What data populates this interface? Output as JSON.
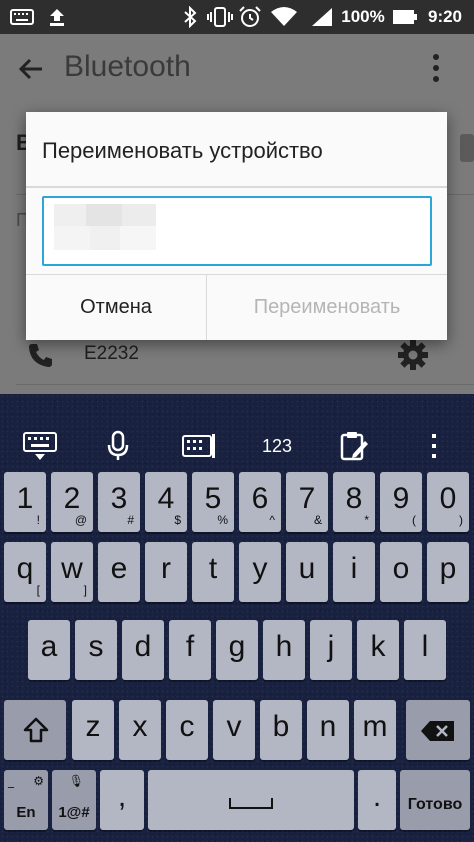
{
  "status_bar": {
    "battery_percent": "100%",
    "time": "9:20",
    "icons": [
      "keyboard-icon",
      "upload-icon",
      "bluetooth-icon",
      "vibrate-icon",
      "alarm-icon",
      "wifi-icon",
      "signal-icon",
      "battery-icon"
    ]
  },
  "app": {
    "title": "Bluetooth",
    "section_letter": "B",
    "paired_letter": "П",
    "devices": [
      {
        "name": "E2232"
      }
    ]
  },
  "dialog": {
    "title": "Переименовать устройство",
    "input_value": "",
    "cancel_label": "Отмена",
    "rename_label": "Переименовать"
  },
  "keyboard": {
    "toolbar_numbers_label": "123",
    "toolbar_icons": [
      "keyboard-hide-icon",
      "microphone-icon",
      "keyboard-mode-icon",
      "clipboard-icon",
      "more-vertical-icon"
    ],
    "rows": [
      [
        {
          "main": "1",
          "sub": "!"
        },
        {
          "main": "2",
          "sub": "@"
        },
        {
          "main": "3",
          "sub": "#"
        },
        {
          "main": "4",
          "sub": "$"
        },
        {
          "main": "5",
          "sub": "%"
        },
        {
          "main": "6",
          "sub": "^"
        },
        {
          "main": "7",
          "sub": "&"
        },
        {
          "main": "8",
          "sub": "*"
        },
        {
          "main": "9",
          "sub": "("
        },
        {
          "main": "0",
          "sub": ")"
        }
      ],
      [
        {
          "main": "q",
          "sub": "["
        },
        {
          "main": "w",
          "sub": "]"
        },
        {
          "main": "e",
          "sub": ""
        },
        {
          "main": "r",
          "sub": ""
        },
        {
          "main": "t",
          "sub": ""
        },
        {
          "main": "y",
          "sub": ""
        },
        {
          "main": "u",
          "sub": ""
        },
        {
          "main": "i",
          "sub": ""
        },
        {
          "main": "o",
          "sub": ""
        },
        {
          "main": "p",
          "sub": ""
        }
      ],
      [
        {
          "main": "a",
          "sub": ""
        },
        {
          "main": "s",
          "sub": ""
        },
        {
          "main": "d",
          "sub": ""
        },
        {
          "main": "f",
          "sub": ""
        },
        {
          "main": "g",
          "sub": ""
        },
        {
          "main": "h",
          "sub": ""
        },
        {
          "main": "j",
          "sub": ""
        },
        {
          "main": "k",
          "sub": ""
        },
        {
          "main": "l",
          "sub": ""
        }
      ],
      [
        {
          "main": "z",
          "sub": ""
        },
        {
          "main": "x",
          "sub": ""
        },
        {
          "main": "c",
          "sub": ""
        },
        {
          "main": "v",
          "sub": ""
        },
        {
          "main": "b",
          "sub": ""
        },
        {
          "main": "n",
          "sub": ""
        },
        {
          "main": "m",
          "sub": ""
        }
      ]
    ],
    "lang_label": "En",
    "symbols_label": "1@#",
    "enter_label": "Готово",
    "key_color": "#b3b7c4",
    "accent_color": "#2aa6d7"
  }
}
